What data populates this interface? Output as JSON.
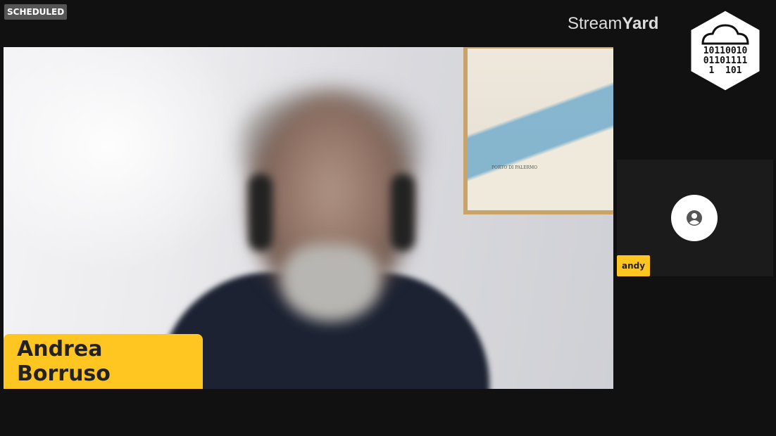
{
  "status_badge": "SCHEDULED",
  "brand": {
    "light_text": "Stream",
    "bold_text": "Yard"
  },
  "channel_logo": {
    "icon": "cloud-binary-icon",
    "binary_lines": [
      "10110010",
      "01101111",
      "1  101"
    ]
  },
  "main_participant": {
    "name": "Andrea Borruso",
    "map_caption": "PORTO DI PALERMO"
  },
  "side_participant": {
    "name": "andy",
    "icon": "account-circle-icon"
  },
  "colors": {
    "accent": "#ffc521",
    "background": "#111111",
    "badge": "#555555"
  }
}
